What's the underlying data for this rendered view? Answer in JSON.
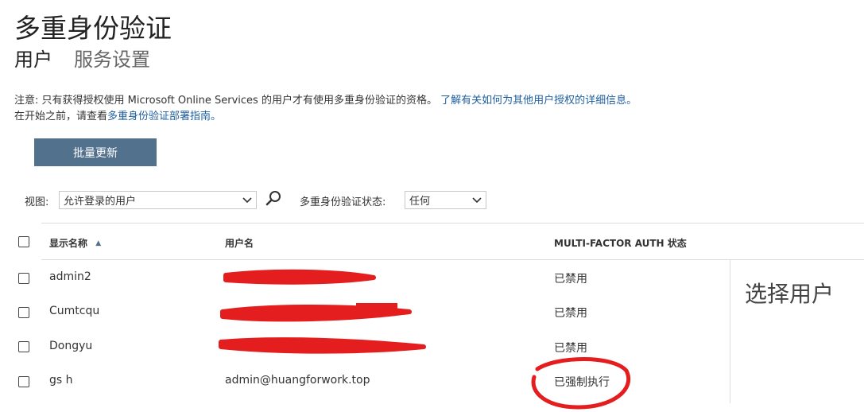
{
  "header": {
    "title": "多重身份验证",
    "tabs": [
      {
        "label": "用户",
        "active": true
      },
      {
        "label": "服务设置",
        "active": false
      }
    ]
  },
  "notice": {
    "line1_text": "注意: 只有获得授权使用 Microsoft Online Services 的用户才有使用多重身份验证的资格。 ",
    "line1_link": "了解有关如何为其他用户授权的详细信息。",
    "line2_text": "在开始之前，请查看",
    "line2_link": "多重身份验证部署指南。"
  },
  "toolbar": {
    "bulk_update_label": "批量更新"
  },
  "filters": {
    "view_label": "视图:",
    "view_value": "允许登录的用户",
    "status_label": "多重身份验证状态:",
    "status_value": "任何"
  },
  "table": {
    "columns": {
      "display_name": "显示名称",
      "username": "用户名",
      "mfa_status": "MULTI-FACTOR AUTH 状态"
    },
    "sort_indicator": "▲",
    "rows": [
      {
        "display_name": "admin2",
        "username": "",
        "mfa_status": "已禁用",
        "redacted": true
      },
      {
        "display_name": "Cumtcqu",
        "username": "",
        "mfa_status": "已禁用",
        "redacted": true
      },
      {
        "display_name": "Dongyu",
        "username": "",
        "mfa_status": "已禁用",
        "redacted": true
      },
      {
        "display_name": "gs h",
        "username": "admin@huangforwork.top",
        "mfa_status": "已强制执行",
        "redacted": false,
        "annotated": true
      }
    ]
  },
  "side_panel": {
    "title": "选择用户"
  },
  "colors": {
    "button_bg": "#52718d",
    "link": "#1f5fa0",
    "redaction": "#e41e1e",
    "divider": "#dcdcdc"
  },
  "icons": [
    "search-icon",
    "chevron-down-icon",
    "sort-ascending-icon"
  ]
}
